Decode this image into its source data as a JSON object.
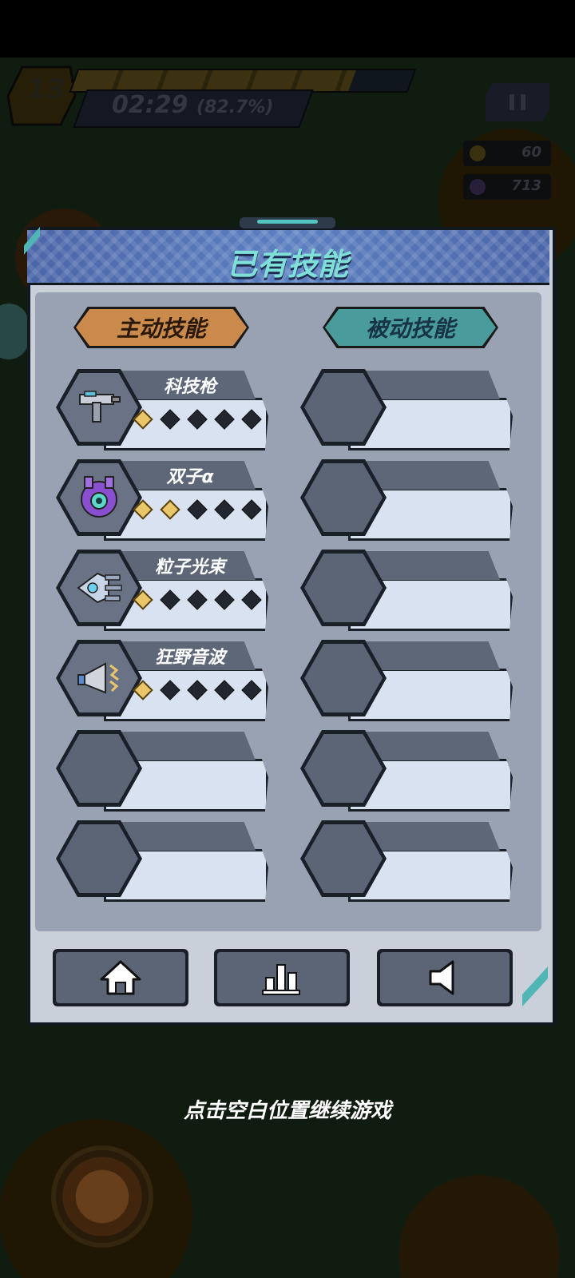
{
  "hud": {
    "level": "13",
    "timer": "02:29",
    "progress_text": "(82.7%)",
    "progress_value": 82.7,
    "gold": "60",
    "gems": "713"
  },
  "dialog": {
    "title": "已有技能",
    "tabs": [
      {
        "label": "主动技能",
        "active": true
      },
      {
        "label": "被动技能",
        "active": false
      }
    ],
    "active_skills": [
      {
        "name": "科技枪",
        "level": 1,
        "max_level": 5,
        "icon": "tech-gun-icon"
      },
      {
        "name": "双子α",
        "level": 2,
        "max_level": 5,
        "icon": "gemini-drone-icon"
      },
      {
        "name": "粒子光束",
        "level": 1,
        "max_level": 5,
        "icon": "particle-beam-icon"
      },
      {
        "name": "狂野音波",
        "level": 1,
        "max_level": 5,
        "icon": "megaphone-icon"
      },
      {
        "name": "",
        "level": 0,
        "max_level": 5,
        "icon": ""
      },
      {
        "name": "",
        "level": 0,
        "max_level": 5,
        "icon": ""
      }
    ],
    "passive_skills": [
      {
        "name": ""
      },
      {
        "name": ""
      },
      {
        "name": ""
      },
      {
        "name": ""
      },
      {
        "name": ""
      },
      {
        "name": ""
      }
    ],
    "buttons": [
      {
        "name": "home",
        "icon": "home-icon"
      },
      {
        "name": "stats",
        "icon": "bar-chart-icon"
      },
      {
        "name": "sound",
        "icon": "speaker-icon"
      }
    ]
  },
  "hint": "点击空白位置继续游戏",
  "colors": {
    "accent_teal": "#7fe0d8",
    "active_tab": "#c98a4c",
    "passive_tab": "#4a9c9c",
    "star_on": "#e9c66a"
  }
}
